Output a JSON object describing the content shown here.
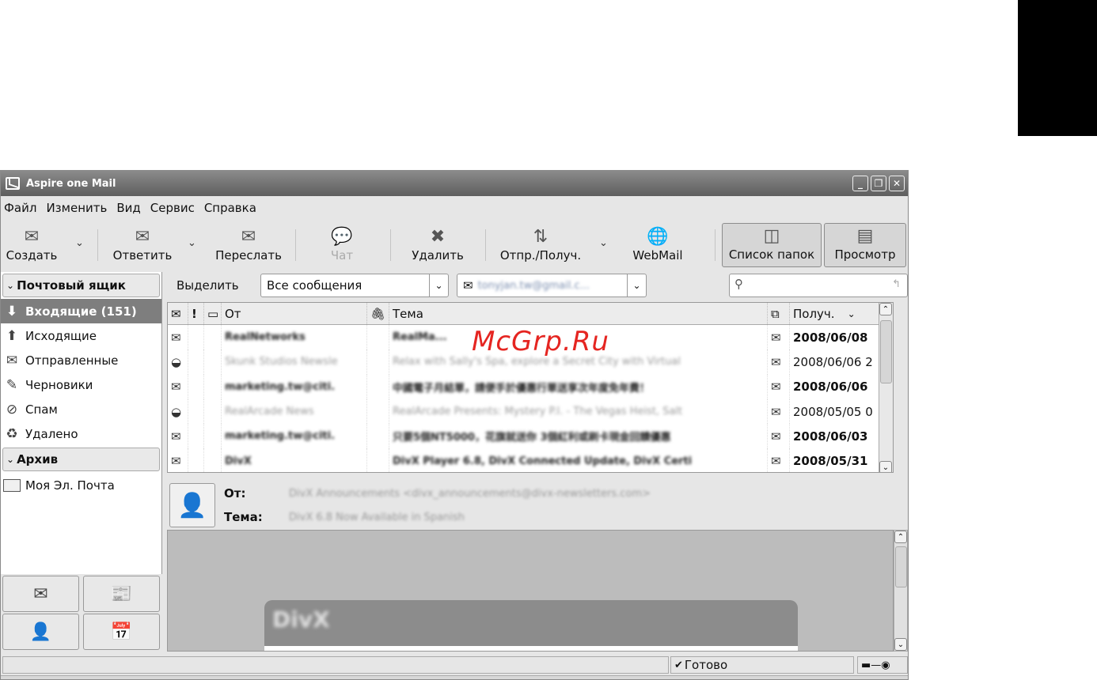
{
  "window": {
    "title": "Aspire one Mail"
  },
  "menu": [
    "Файл",
    "Изменить",
    "Вид",
    "Сервис",
    "Справка"
  ],
  "toolbar": {
    "create": "Создать",
    "reply": "Ответить",
    "forward": "Переслать",
    "chat": "Чат",
    "delete": "Удалить",
    "send_receive": "Отпр./Получ.",
    "webmail": "WebMail",
    "folder_list": "Список папок",
    "preview": "Просмотр"
  },
  "sidebar": {
    "mailbox_header": "Почтовый ящик",
    "folders": [
      {
        "label": "Входящие (151)",
        "icon": "inbox-icon"
      },
      {
        "label": "Исходящие",
        "icon": "outbox-icon"
      },
      {
        "label": "Отправленные",
        "icon": "sent-icon"
      },
      {
        "label": "Черновики",
        "icon": "drafts-icon"
      },
      {
        "label": "Спам",
        "icon": "spam-icon"
      },
      {
        "label": "Удалено",
        "icon": "trash-icon"
      }
    ],
    "archive_header": "Архив",
    "archive_folders": [
      {
        "label": "Моя Эл. Почта"
      }
    ]
  },
  "filter": {
    "select_label": "Выделить",
    "select_value": "Все сообщения",
    "account": "tonyjan.tw@gmail.c..."
  },
  "columns": {
    "from": "От",
    "subject": "Тема",
    "received": "Получ."
  },
  "messages": [
    {
      "from": "RealNetworks",
      "subject": "RealMa...",
      "date": "2008/06/08",
      "unread": true
    },
    {
      "from": "Skunk Studios Newsle",
      "subject": "Relax with Sally's Spa, explore a Secret City with Virtual",
      "date": "2008/06/06 2",
      "unread": false
    },
    {
      "from": "marketing.tw@citi.",
      "subject": "中國電子月結單，請便手於優惠行單送享次年度免年費！",
      "date": "2008/06/06",
      "unread": true
    },
    {
      "from": "RealArcade News",
      "subject": "RealArcade Presents: Mystery P.I. - The Vegas Heist, Salt",
      "date": "2008/05/05 0",
      "unread": false
    },
    {
      "from": "marketing.tw@citi.",
      "subject": "只要5個NT5000，花旗就送你 3個紅利或刷卡現金回饋優惠",
      "date": "2008/06/03",
      "unread": true
    },
    {
      "from": "DivX",
      "subject": "DivX Player 6.8, DivX Connected Update, DivX Certi",
      "date": "2008/05/31",
      "unread": true
    }
  ],
  "preview": {
    "from_label": "От:",
    "from_value": "DivX Announcements <divx_announcements@divx-newsletters.com>",
    "subject_label": "Тема:",
    "subject_value": "DivX 6.8 Now Available in Spanish",
    "banner_text": "DivX"
  },
  "status": {
    "text": "Готово"
  },
  "watermark": "McGrp.Ru"
}
